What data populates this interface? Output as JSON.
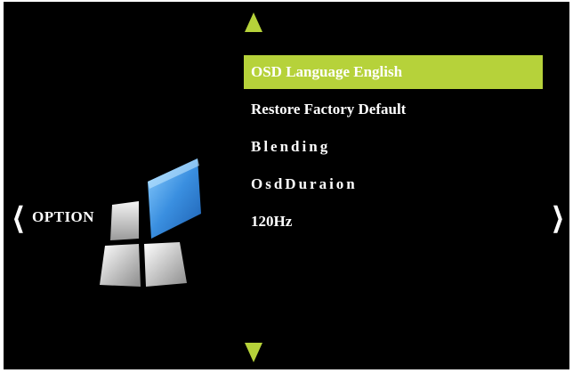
{
  "option": {
    "label": "OPTION",
    "nav_left_glyph": "❮",
    "nav_right_glyph": "❯"
  },
  "logo": {
    "icon": "option-tiles-icon",
    "accent_color": "#3a8fe0"
  },
  "menu": {
    "items": [
      {
        "label": "OSD  Language English",
        "selected": true
      },
      {
        "label": "Restore Factory Default",
        "selected": false
      },
      {
        "label": "Blending",
        "selected": false
      },
      {
        "label": "OsdDuraion",
        "selected": false
      },
      {
        "label": "120Hz",
        "selected": false
      }
    ]
  },
  "colors": {
    "background": "#000000",
    "highlight": "#b6d23a",
    "text": "#ffffff"
  }
}
